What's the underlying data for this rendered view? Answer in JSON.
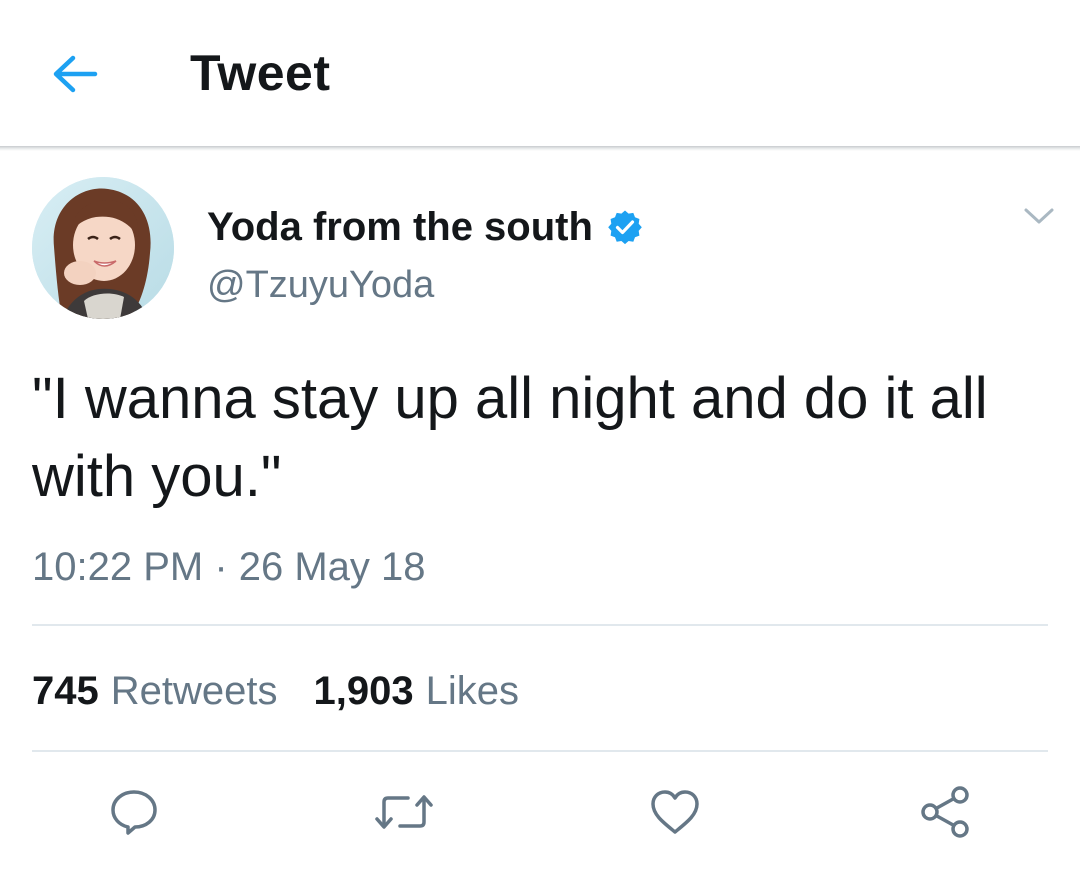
{
  "header": {
    "back_icon": "arrow-left-icon",
    "title": "Tweet"
  },
  "author": {
    "display_name": "Yoda from the south",
    "handle": "@TzuyuYoda",
    "verified": true,
    "verified_icon": "verified-badge-icon"
  },
  "tweet": {
    "text": "\"I wanna stay up all night and do it all with you.\"",
    "timestamp": "10:22 PM · 26 May 18"
  },
  "stats": {
    "retweets_count": "745",
    "retweets_label": "Retweets",
    "likes_count": "1,903",
    "likes_label": "Likes"
  },
  "actions": [
    "reply-icon",
    "retweet-icon",
    "like-icon",
    "share-icon"
  ],
  "colors": {
    "accent": "#1da1f2",
    "text_primary": "#14171a",
    "text_secondary": "#657786",
    "divider": "#e1e8ed",
    "icon_gray": "#657786"
  }
}
